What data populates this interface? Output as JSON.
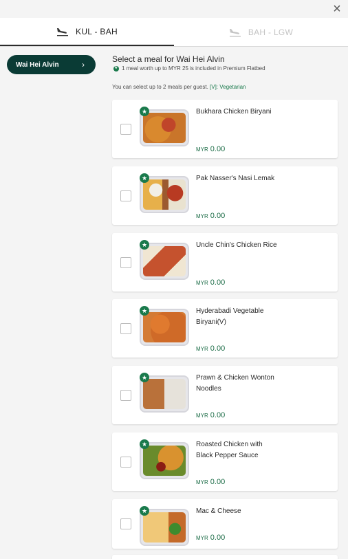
{
  "close_icon": "close-icon",
  "tabs": [
    {
      "label": "KUL - BAH",
      "icon": "plane-landing-icon",
      "active": true
    },
    {
      "label": "BAH - LGW",
      "icon": "plane-landing-icon",
      "active": false
    }
  ],
  "sidebar": {
    "passenger_name": "Wai Hei Alvin",
    "chevron": "›"
  },
  "main": {
    "heading": "Select a meal for Wai Hei Alvin",
    "included_note": "1 meal worth up to MYR 25 is included in Premium Flatbed",
    "limit_note_prefix": "You can select up to 2 meals per guest. ",
    "limit_note_veg": "[V]: Vegetarian"
  },
  "colors": {
    "brand_dark": "#0a3b35",
    "accent_green": "#1a7a4c",
    "price_green": "#1a6b45"
  },
  "meals": [
    {
      "name": "Bukhara Chicken Biryani",
      "currency": "MYR",
      "price": "0.00",
      "badge": "★",
      "checked": false
    },
    {
      "name": "Pak Nasser's Nasi Lemak",
      "currency": "MYR",
      "price": "0.00",
      "badge": "★",
      "checked": false
    },
    {
      "name": "Uncle Chin's Chicken Rice",
      "currency": "MYR",
      "price": "0.00",
      "badge": "★",
      "checked": false
    },
    {
      "name": "Hyderabadi Vegetable Biryani(V)",
      "currency": "MYR",
      "price": "0.00",
      "badge": "★",
      "checked": false
    },
    {
      "name": "Prawn & Chicken Wonton Noodles",
      "currency": "MYR",
      "price": "0.00",
      "badge": "★",
      "checked": false
    },
    {
      "name": "Roasted Chicken with Black Pepper Sauce",
      "currency": "MYR",
      "price": "0.00",
      "badge": "★",
      "checked": false
    },
    {
      "name": "Mac & Cheese",
      "currency": "MYR",
      "price": "0.00",
      "badge": "★",
      "checked": false
    }
  ]
}
